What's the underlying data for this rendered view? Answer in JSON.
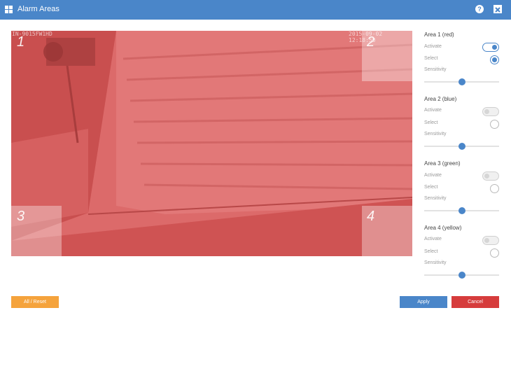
{
  "window": {
    "title": "Alarm Areas",
    "help_icon": "question-circle-icon",
    "close_icon": "close-icon"
  },
  "camera": {
    "overlay_color": "#d95a5a",
    "timestamp_left": "IN-9015FW1HD",
    "timestamp_right": "2015-09-02 12:18:50",
    "area_numbers": [
      "1",
      "2",
      "3",
      "4"
    ]
  },
  "areas": [
    {
      "title": "Area 1 (red)",
      "activate_label": "Activate",
      "select_label": "Select",
      "sensitivity_label": "Sensitivity",
      "active": true,
      "selected": true,
      "sensitivity": 0.5
    },
    {
      "title": "Area 2 (blue)",
      "activate_label": "Activate",
      "select_label": "Select",
      "sensitivity_label": "Sensitivity",
      "active": false,
      "selected": false,
      "sensitivity": 0.5
    },
    {
      "title": "Area 3 (green)",
      "activate_label": "Activate",
      "select_label": "Select",
      "sensitivity_label": "Sensitivity",
      "active": false,
      "selected": false,
      "sensitivity": 0.5
    },
    {
      "title": "Area 4 (yellow)",
      "activate_label": "Activate",
      "select_label": "Select",
      "sensitivity_label": "Sensitivity",
      "active": false,
      "selected": false,
      "sensitivity": 0.5
    }
  ],
  "buttons": {
    "reset": "All / Reset",
    "apply": "Apply",
    "cancel": "Cancel"
  },
  "colors": {
    "titlebar": "#4a86c9",
    "accent": "#4a86c9",
    "reset": "#f5a33c",
    "cancel": "#d63c3c"
  }
}
